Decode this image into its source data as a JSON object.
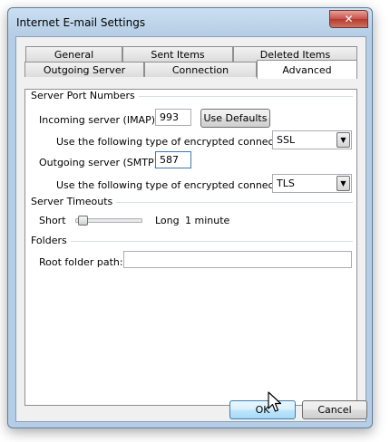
{
  "window": {
    "title": "Internet E-mail Settings",
    "close_glyph": "✕"
  },
  "tabs": {
    "row1": [
      "General",
      "Sent Items",
      "Deleted Items"
    ],
    "row2": [
      "Outgoing Server",
      "Connection",
      "Advanced"
    ],
    "active": "Advanced"
  },
  "server_ports": {
    "group_label": "Server Port Numbers",
    "incoming_label": "Incoming server (IMAP):",
    "incoming_value": "993",
    "use_defaults_label": "Use Defaults",
    "incoming_enc_label": "Use the following type of encrypted connection:",
    "incoming_enc_value": "SSL",
    "outgoing_label": "Outgoing server (SMTP):",
    "outgoing_value": "587",
    "outgoing_enc_label": "Use the following type of encrypted connection:",
    "outgoing_enc_value": "TLS"
  },
  "timeouts": {
    "group_label": "Server Timeouts",
    "short_label": "Short",
    "long_label": "Long",
    "value_text": "1 minute",
    "slider_fraction": 0.05
  },
  "folders": {
    "group_label": "Folders",
    "root_label": "Root folder path:",
    "root_value": ""
  },
  "buttons": {
    "ok": "OK",
    "cancel": "Cancel"
  },
  "icons": {
    "dropdown": "chevron-down-icon",
    "close": "close-icon",
    "pointer": "mouse-pointer-icon"
  }
}
